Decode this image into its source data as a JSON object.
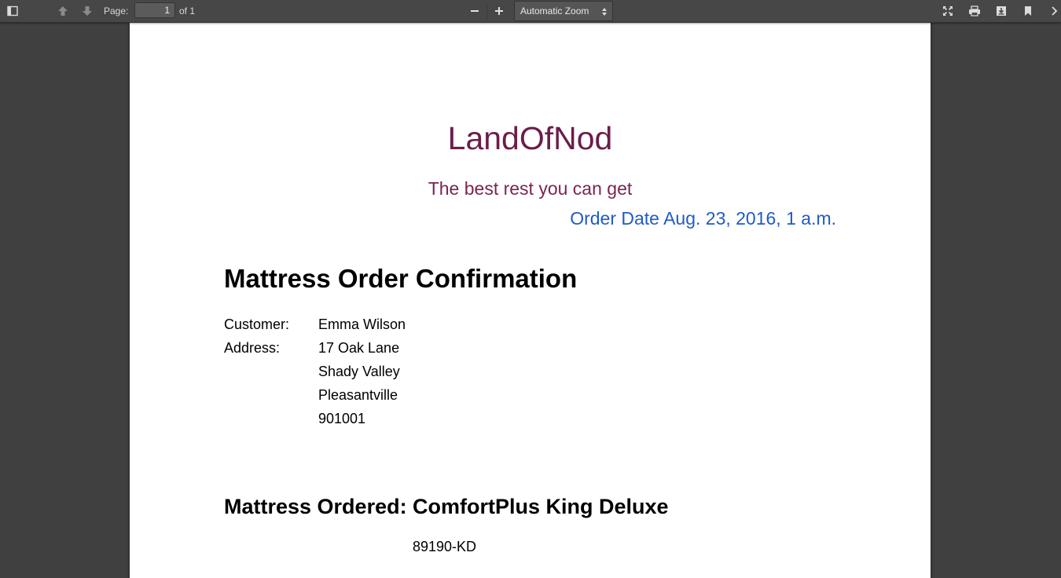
{
  "toolbar": {
    "page_label": "Page:",
    "page_value": "1",
    "page_count": "of 1",
    "zoom_value": "Automatic Zoom",
    "icons": [
      "sidebar-toggle-icon",
      "previous-page-icon",
      "next-page-icon",
      "zoom-out-icon",
      "zoom-in-icon",
      "presentation-mode-icon",
      "print-icon",
      "download-icon",
      "bookmark-icon",
      "tools-icon"
    ]
  },
  "document": {
    "brand": "LandOfNod",
    "tagline": "The best rest you can get",
    "order_date": "Order Date Aug. 23, 2016, 1 a.m.",
    "title": "Mattress Order Confirmation",
    "customer_label": "Customer:",
    "customer_name": "Emma Wilson",
    "address_label": "Address:",
    "address_lines": [
      "17 Oak Lane",
      "Shady Valley",
      "Pleasantville",
      "901001"
    ],
    "ordered_label": "Mattress Ordered:",
    "mattress_name": "ComfortPlus King Deluxe",
    "sku": "89190-KD",
    "colors": {
      "brand": "#6b1d4a",
      "tagline": "#7a2552",
      "order_date": "#1f5bc8"
    }
  }
}
